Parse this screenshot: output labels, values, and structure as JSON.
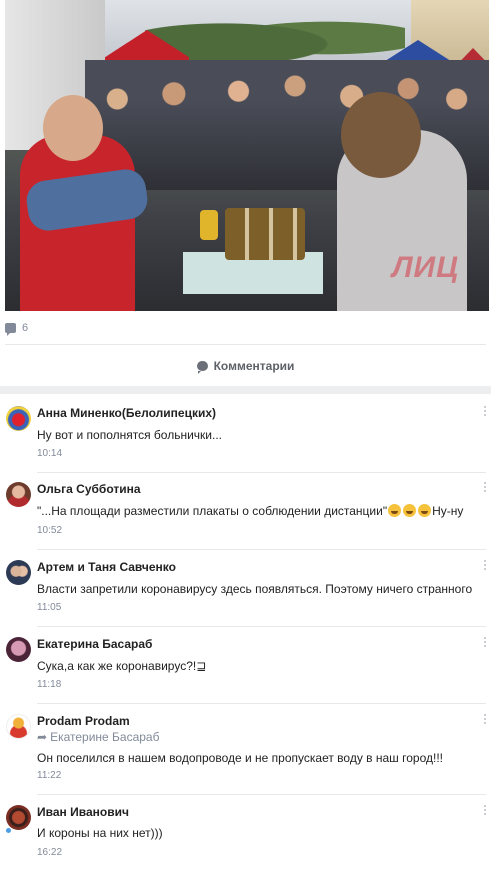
{
  "post": {
    "comment_count": "6",
    "comments_title": "Комментарии",
    "photo_watermark": "ЛИЦ"
  },
  "colors": {
    "link": "#2a5885",
    "secondary_text": "#828a99",
    "divider": "#e7e8ec",
    "band": "#edeef0"
  },
  "comments": [
    {
      "author": "Анна Миненко(Белолипецких)",
      "text": "Ну вот и пополнятся больнички...",
      "time": "10:14"
    },
    {
      "author": "Ольга Субботина",
      "text": "\"...На площади разместили плакаты о соблюдении дистанции\"",
      "text_tail": "Ну-ну",
      "time": "10:52"
    },
    {
      "author": "Артем и Таня Савченко",
      "text": "Власти запретили коронавирусу здесь появляться. Поэтому ничего странного",
      "time": "11:05"
    },
    {
      "author": "Екатерина Басараб",
      "text": "Сука,а как же коронавирус?!⊒",
      "time": "11:18"
    },
    {
      "author": "Prodam Prodam",
      "reply_to": "Екатерине Басараб",
      "text": "Он поселился в нашем водопроводе и не пропускает воду в наш город!!!",
      "time": "11:22"
    },
    {
      "author": "Иван Иванович",
      "text": "И короны на них нет)))",
      "time": "16:22"
    }
  ]
}
